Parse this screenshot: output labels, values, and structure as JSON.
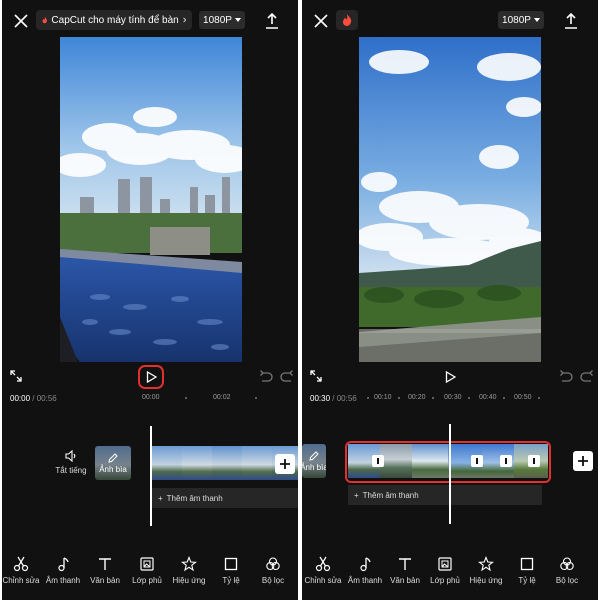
{
  "left": {
    "promo_text": "CapCut cho máy tính để bàn",
    "resolution": "1080P",
    "time_current": "00:00",
    "time_separator": "/",
    "time_total": "00:56",
    "ruler": [
      "00:00",
      "00:02"
    ],
    "mute_label": "Tắt tiếng",
    "cover_label": "Ảnh bìa",
    "add_audio_label": "Thêm âm thanh"
  },
  "right": {
    "resolution": "1080P",
    "time_current": "00:30",
    "time_separator": "/",
    "time_total": "00:56",
    "ruler": [
      "00:10",
      "00:20",
      "00:30",
      "00:40",
      "00:50"
    ],
    "cover_label": "Ảnh bìa",
    "add_audio_label": "Thêm âm thanh"
  },
  "toolbar_left": [
    "Chỉnh sửa",
    "Âm thanh",
    "Văn bản",
    "Lớp phủ",
    "Hiệu ứng",
    "Tỷ lệ",
    "Bộ lọc"
  ],
  "toolbar_right": [
    "Chỉnh sửa",
    "Âm thanh",
    "Văn bản",
    "Lớp phủ",
    "Hiệu ứng",
    "Tỷ lệ",
    "Bộ lọc"
  ],
  "icons": {
    "close": "close-icon",
    "flame": "flame-icon",
    "chevron": "chevron-right-icon",
    "export": "export-icon",
    "fullscreen": "fullscreen-icon",
    "play": "play-icon",
    "undo": "undo-icon",
    "redo": "redo-icon",
    "speaker": "speaker-icon",
    "edit": "pencil-icon",
    "add": "plus-icon"
  },
  "colors": {
    "background": "#111111",
    "highlight": "#e0312e",
    "flame": "#ff4d3d",
    "surface": "#262626"
  }
}
